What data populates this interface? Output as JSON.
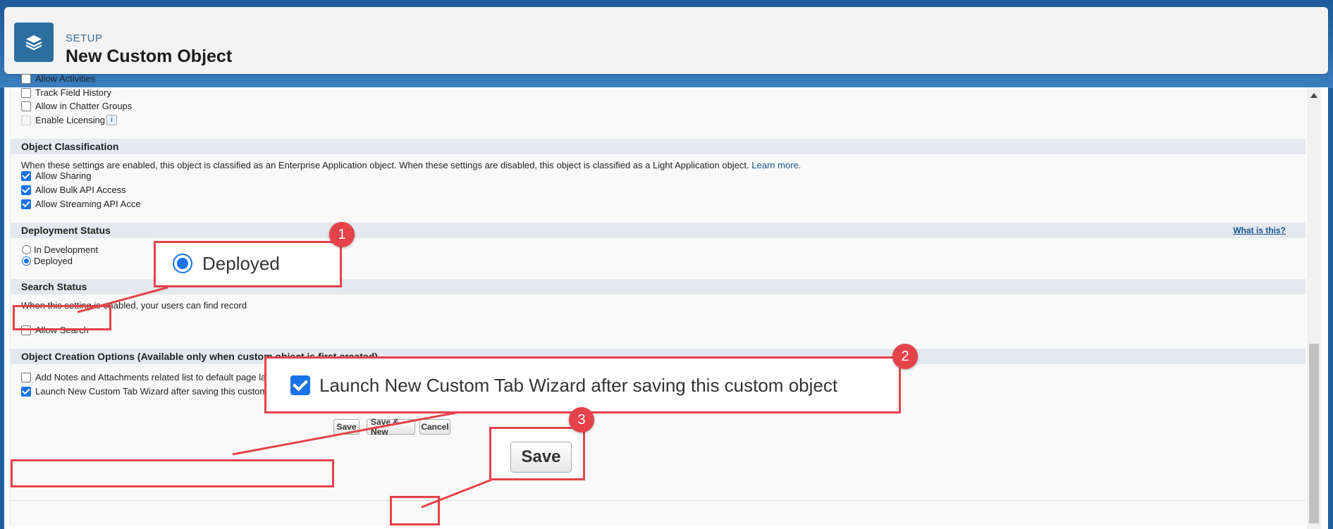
{
  "header": {
    "eyebrow": "SETUP",
    "title": "New Custom Object",
    "icon": "layers-icon"
  },
  "features": [
    {
      "label": "Allow Activities",
      "checked": false
    },
    {
      "label": "Track Field History",
      "checked": false
    },
    {
      "label": "Allow in Chatter Groups",
      "checked": false
    },
    {
      "label": "Enable Licensing",
      "checked": false,
      "disabled": true
    }
  ],
  "classification": {
    "heading": "Object Classification",
    "description": "When these settings are enabled, this object is classified as an Enterprise Application object. When these settings are disabled, this object is classified as a Light Application object.",
    "learn_more": "Learn more.",
    "options": [
      {
        "label": "Allow Sharing",
        "checked": true
      },
      {
        "label": "Allow Bulk API Access",
        "checked": true
      },
      {
        "label": "Allow Streaming API Acce",
        "checked": true
      }
    ]
  },
  "deployment": {
    "heading": "Deployment Status",
    "help": "What is this?",
    "options": [
      {
        "label": "In Development",
        "selected": false
      },
      {
        "label": "Deployed",
        "selected": true
      }
    ]
  },
  "search": {
    "heading": "Search Status",
    "description": "When this setting is enabled, your users can find record",
    "option": {
      "label": "Allow Search",
      "checked": false
    }
  },
  "creation": {
    "heading": "Object Creation Options (Available only when custom object is first created)",
    "options": [
      {
        "label": "Add Notes and Attachments related list to default page layout",
        "checked": false
      },
      {
        "label": "Launch New Custom Tab Wizard after saving this custom object",
        "checked": true
      }
    ]
  },
  "buttons": {
    "save": "Save",
    "save_new": "Save & New",
    "cancel": "Cancel"
  },
  "annotations": {
    "callout1": {
      "number": "1",
      "text": "Deployed"
    },
    "callout2": {
      "number": "2",
      "text": "Launch New Custom Tab Wizard after saving this custom object"
    },
    "callout3": {
      "number": "3",
      "text": "Save"
    },
    "color": "#e5424a"
  }
}
